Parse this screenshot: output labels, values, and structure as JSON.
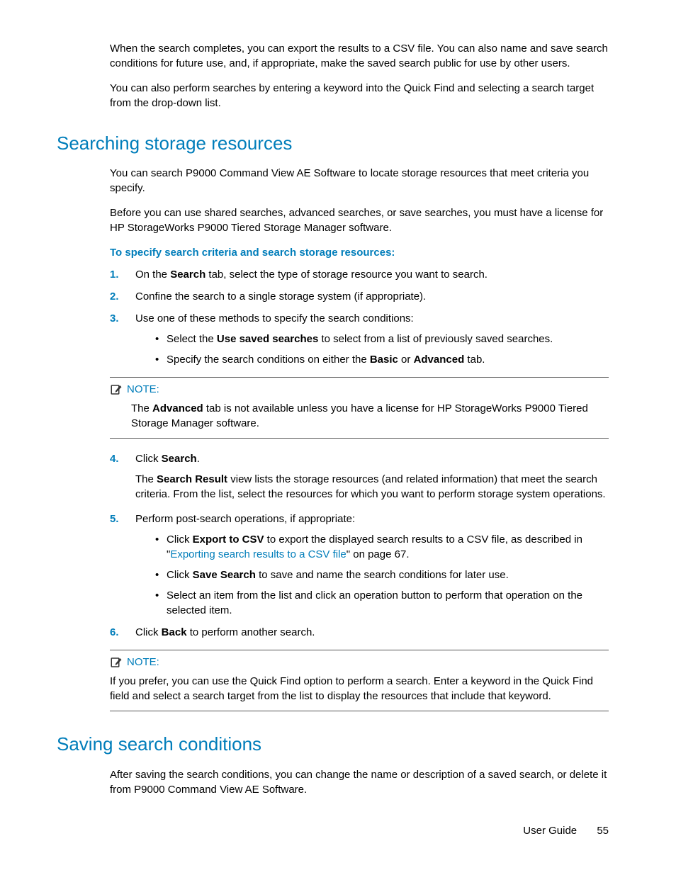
{
  "intro": {
    "p1": "When the search completes, you can export the results to a CSV file. You can also name and save search conditions for future use, and, if appropriate, make the saved search public for use by other users.",
    "p2": "You can also perform searches by entering a keyword into the Quick Find and selecting a search target from the drop-down list."
  },
  "section1": {
    "heading": "Searching storage resources",
    "p1": "You can search P9000 Command View AE Software to locate storage resources that meet criteria you specify.",
    "p2": "Before you can use shared searches, advanced searches, or save searches, you must have a license for HP StorageWorks P9000 Tiered Storage Manager software.",
    "lead": "To specify search criteria and search storage resources:",
    "steps": {
      "s1_a": "On the ",
      "s1_b": "Search",
      "s1_c": " tab, select the type of storage resource you want to search.",
      "s2": "Confine the search to a single storage system (if appropriate).",
      "s3": "Use one of these methods to specify the search conditions:",
      "s3_b1_a": "Select the ",
      "s3_b1_b": "Use saved searches",
      "s3_b1_c": " to select from a list of previously saved searches.",
      "s3_b2_a": "Specify the search conditions on either the ",
      "s3_b2_b": "Basic",
      "s3_b2_c": " or ",
      "s3_b2_d": "Advanced",
      "s3_b2_e": " tab.",
      "s4_a": "Click ",
      "s4_b": "Search",
      "s4_c": ".",
      "s4_p_a": "The ",
      "s4_p_b": "Search Result",
      "s4_p_c": " view lists the storage resources (and related information) that meet the search criteria. From the list, select the resources for which you want to perform storage system operations.",
      "s5": "Perform post-search operations, if appropriate:",
      "s5_b1_a": "Click ",
      "s5_b1_b": "Export to CSV",
      "s5_b1_c": " to export the displayed search results to a CSV file, as described in \"",
      "s5_b1_link": "Exporting search results to a CSV file",
      "s5_b1_d": "\" on page 67.",
      "s5_b2_a": "Click ",
      "s5_b2_b": "Save Search",
      "s5_b2_c": " to save and name the search conditions for later use.",
      "s5_b3": "Select an item from the list and click an operation button to perform that operation on the selected item.",
      "s6_a": "Click ",
      "s6_b": "Back",
      "s6_c": " to perform another search."
    },
    "note1": {
      "label": "NOTE:",
      "body_a": "The ",
      "body_b": "Advanced",
      "body_c": " tab is not available unless you have a license for HP StorageWorks P9000 Tiered Storage Manager software."
    },
    "note2": {
      "label": "NOTE:",
      "body": "If you prefer, you can use the Quick Find option to perform a search. Enter a keyword in the Quick Find field and select a search target from the list to display the resources that include that keyword."
    }
  },
  "section2": {
    "heading": "Saving search conditions",
    "p1": "After saving the search conditions, you can change the name or description of a saved search, or delete it from P9000 Command View AE Software."
  },
  "footer": {
    "title": "User Guide",
    "page": "55"
  },
  "numbers": {
    "n1": "1.",
    "n2": "2.",
    "n3": "3.",
    "n4": "4.",
    "n5": "5.",
    "n6": "6."
  }
}
